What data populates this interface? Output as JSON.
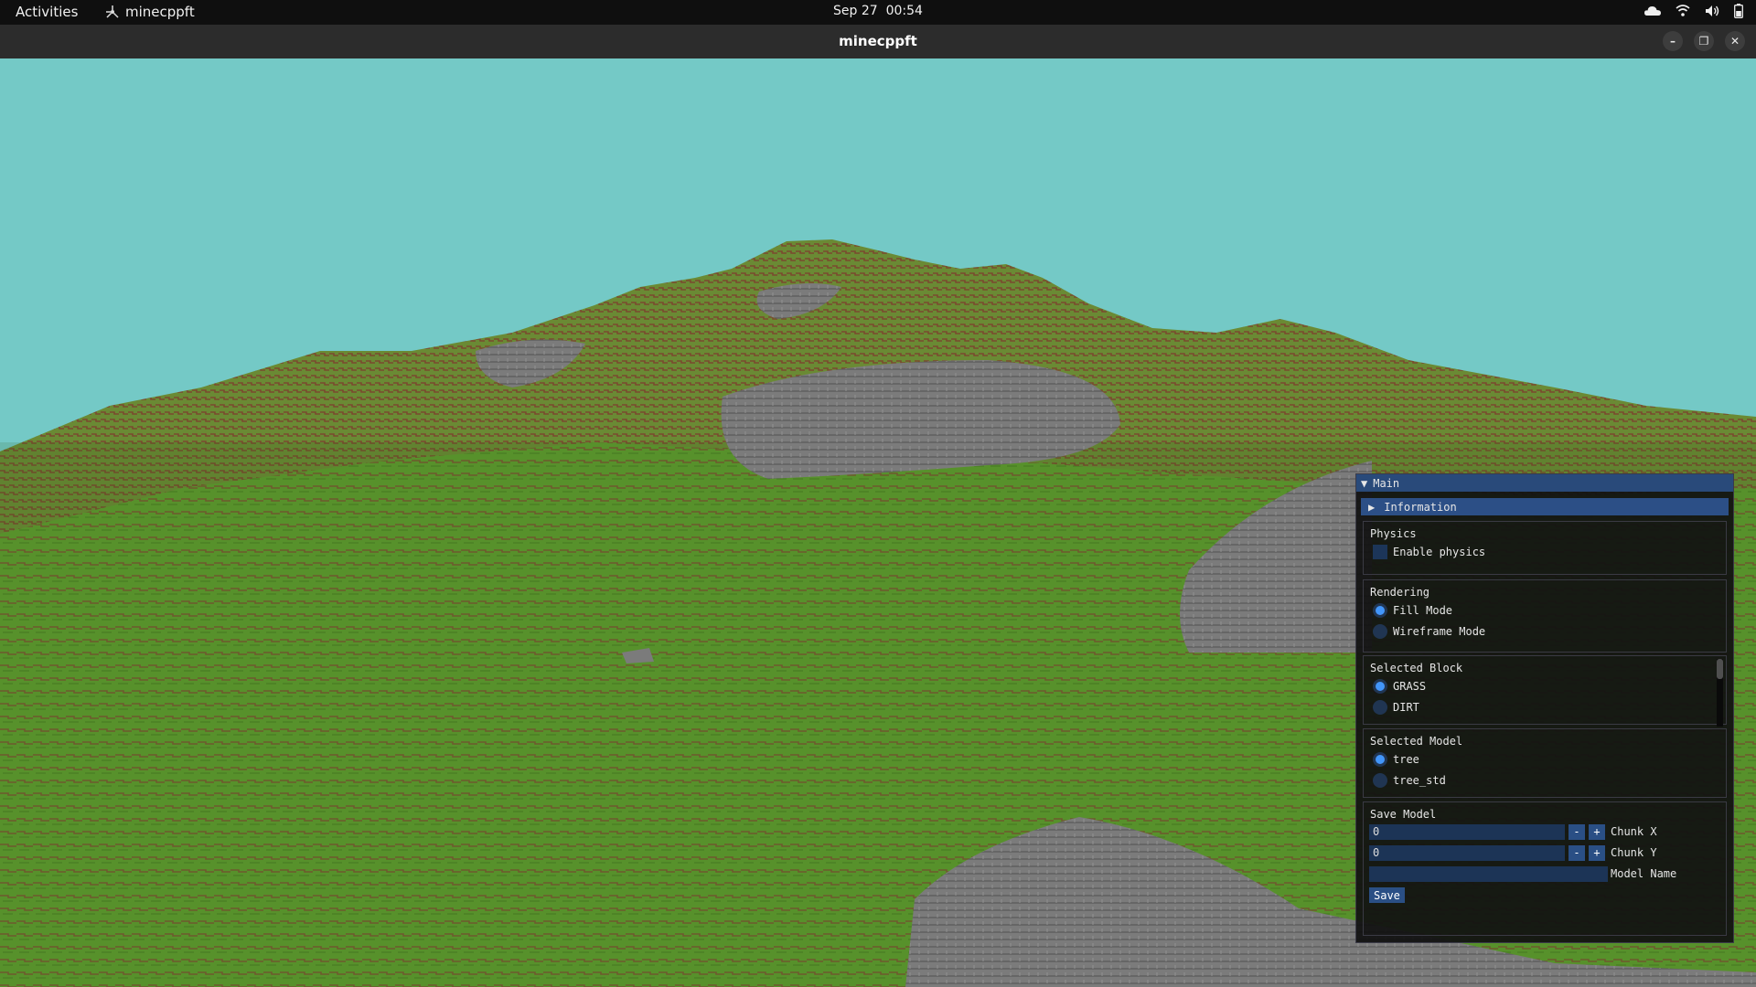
{
  "topbar": {
    "activities": "Activities",
    "app_name": "minecppft",
    "date": "Sep 27",
    "time": "00:54"
  },
  "window": {
    "title": "minecppft"
  },
  "scene": {
    "sky_color": "#74c9c6",
    "grass_color": "#5f9c2e",
    "stone_color": "#7d7d7d"
  },
  "imgui": {
    "window_title": "Main",
    "info_header": "Information",
    "physics": {
      "section": "Physics",
      "enable_label": "Enable physics",
      "enabled": false
    },
    "rendering": {
      "section": "Rendering",
      "options": [
        "Fill Mode",
        "Wireframe Mode"
      ],
      "selected": "Fill Mode"
    },
    "selected_block": {
      "section": "Selected Block",
      "options": [
        "GRASS",
        "DIRT"
      ],
      "selected": "GRASS"
    },
    "selected_model": {
      "section": "Selected Model",
      "options": [
        "tree",
        "tree_std"
      ],
      "selected": "tree"
    },
    "save_model": {
      "section": "Save Model",
      "chunk_x_value": "0",
      "chunk_x_label": "Chunk X",
      "chunk_y_value": "0",
      "chunk_y_label": "Chunk Y",
      "model_name_value": "",
      "model_name_label": "Model Name",
      "minus": "-",
      "plus": "+",
      "save_label": "Save"
    }
  }
}
